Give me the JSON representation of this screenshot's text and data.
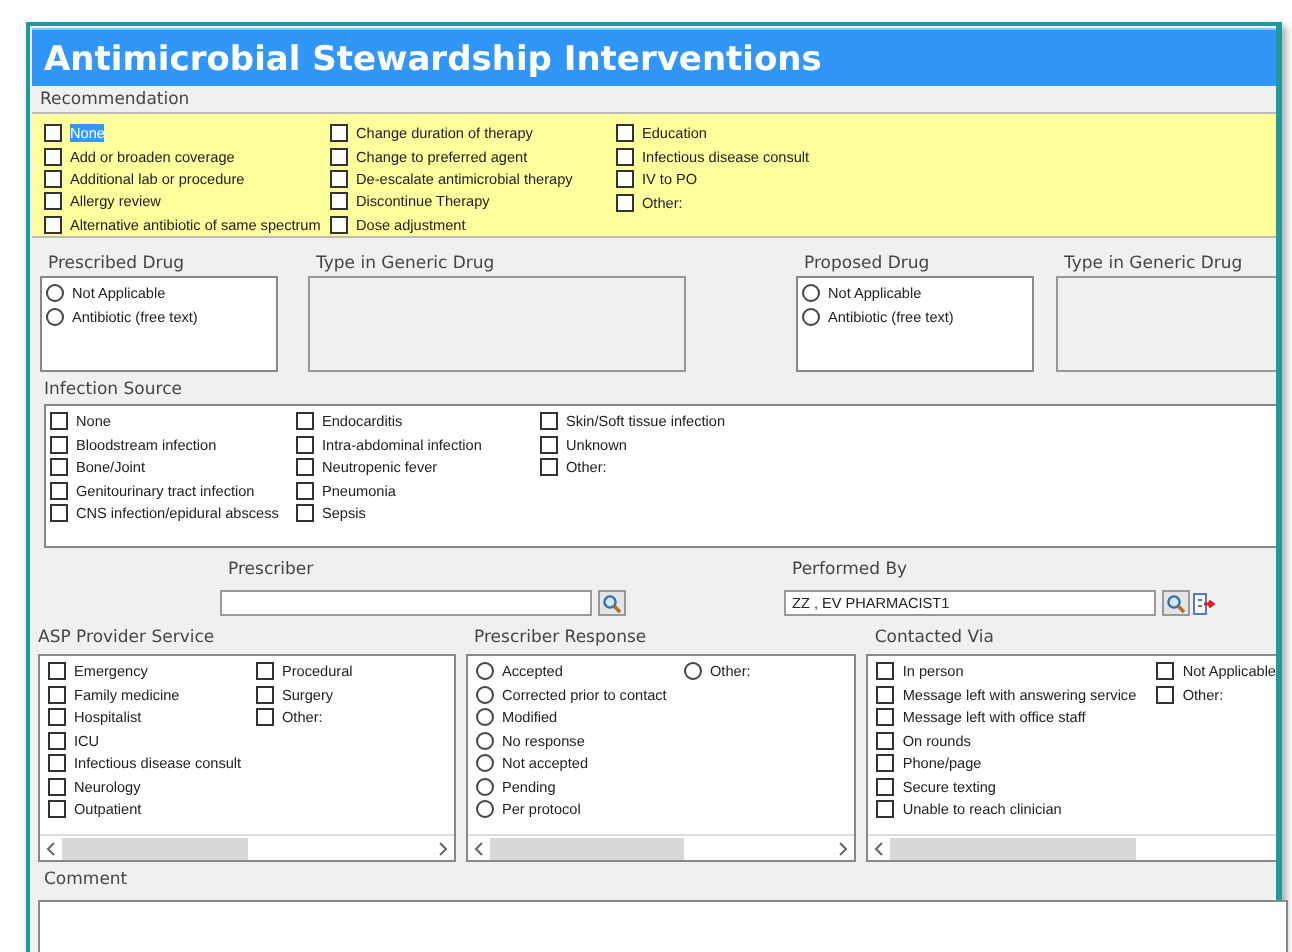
{
  "window": {
    "title": "Antimicrobial Stewardship Interventions"
  },
  "recommendation": {
    "label": "Recommendation",
    "columns": [
      [
        {
          "label": "None",
          "checked": false,
          "focused": true
        },
        {
          "label": "Add or broaden coverage",
          "checked": false,
          "focused": false
        },
        {
          "label": "Additional lab or procedure",
          "checked": false,
          "focused": false
        },
        {
          "label": "Allergy review",
          "checked": false,
          "focused": false
        },
        {
          "label": "Alternative antibiotic of same spectrum",
          "checked": false,
          "focused": false
        }
      ],
      [
        {
          "label": "Change duration of therapy",
          "checked": false,
          "focused": false
        },
        {
          "label": "Change to preferred agent",
          "checked": false,
          "focused": false
        },
        {
          "label": "De-escalate antimicrobial therapy",
          "checked": false,
          "focused": false
        },
        {
          "label": "Discontinue Therapy",
          "checked": false,
          "focused": false
        },
        {
          "label": "Dose adjustment",
          "checked": false,
          "focused": false
        }
      ],
      [
        {
          "label": "Education",
          "checked": false,
          "focused": false
        },
        {
          "label": "Infectious disease consult",
          "checked": false,
          "focused": false
        },
        {
          "label": "IV to PO",
          "checked": false,
          "focused": false
        },
        {
          "label": "Other:",
          "checked": false,
          "focused": false
        }
      ]
    ]
  },
  "prescribed_drug": {
    "label": "Prescribed Drug",
    "options": [
      {
        "label": "Not Applicable",
        "selected": false
      },
      {
        "label": "Antibiotic (free text)",
        "selected": false
      }
    ]
  },
  "prescribed_generic": {
    "label": "Type in Generic Drug"
  },
  "proposed_drug": {
    "label": "Proposed Drug",
    "options": [
      {
        "label": "Not Applicable",
        "selected": false
      },
      {
        "label": "Antibiotic (free text)",
        "selected": false
      }
    ]
  },
  "proposed_generic": {
    "label": "Type in Generic Drug"
  },
  "infection_source": {
    "label": "Infection Source",
    "columns": [
      [
        {
          "label": "None",
          "checked": false
        },
        {
          "label": "Bloodstream infection",
          "checked": false
        },
        {
          "label": "Bone/Joint",
          "checked": false
        },
        {
          "label": "Genitourinary tract infection",
          "checked": false
        },
        {
          "label": "CNS infection/epidural abscess",
          "checked": false
        }
      ],
      [
        {
          "label": "Endocarditis",
          "checked": false
        },
        {
          "label": "Intra-abdominal infection",
          "checked": false
        },
        {
          "label": "Neutropenic fever",
          "checked": false
        },
        {
          "label": "Pneumonia",
          "checked": false
        },
        {
          "label": "Sepsis",
          "checked": false
        }
      ],
      [
        {
          "label": "Skin/Soft tissue infection",
          "checked": false
        },
        {
          "label": "Unknown",
          "checked": false
        },
        {
          "label": "Other:",
          "checked": false
        }
      ]
    ]
  },
  "prescriber": {
    "label": "Prescriber"
  },
  "performed_by": {
    "label": "Performed By",
    "value": "ZZ , EV PHARMACIST1"
  },
  "asp_provider_service": {
    "label": "ASP Provider Service",
    "columns": [
      [
        {
          "label": "Emergency",
          "checked": false
        },
        {
          "label": "Family medicine",
          "checked": false
        },
        {
          "label": "Hospitalist",
          "checked": false
        },
        {
          "label": "ICU",
          "checked": false
        },
        {
          "label": "Infectious disease consult",
          "checked": false
        },
        {
          "label": "Neurology",
          "checked": false
        },
        {
          "label": "Outpatient",
          "checked": false
        }
      ],
      [
        {
          "label": "Procedural",
          "checked": false
        },
        {
          "label": "Surgery",
          "checked": false
        },
        {
          "label": "Other:",
          "checked": false
        }
      ]
    ]
  },
  "prescriber_response": {
    "label": "Prescriber Response",
    "columns": [
      [
        {
          "label": "Accepted",
          "selected": false
        },
        {
          "label": "Corrected prior to contact",
          "selected": false
        },
        {
          "label": "Modified",
          "selected": false
        },
        {
          "label": "No response",
          "selected": false
        },
        {
          "label": "Not accepted",
          "selected": false
        },
        {
          "label": "Pending",
          "selected": false
        },
        {
          "label": "Per protocol",
          "selected": false
        }
      ],
      [
        {
          "label": "Other:",
          "selected": false
        }
      ]
    ]
  },
  "contacted_via": {
    "label": "Contacted Via",
    "columns": [
      [
        {
          "label": "In person",
          "checked": false
        },
        {
          "label": "Message left with answering service",
          "checked": false
        },
        {
          "label": "Message left with office staff",
          "checked": false
        },
        {
          "label": "On rounds",
          "checked": false
        },
        {
          "label": "Phone/page",
          "checked": false
        },
        {
          "label": "Secure texting",
          "checked": false
        },
        {
          "label": "Unable to reach clinician",
          "checked": false
        }
      ],
      [
        {
          "label": "Not Applicable",
          "checked": false
        },
        {
          "label": "Other:",
          "checked": false
        }
      ]
    ]
  },
  "comment": {
    "label": "Comment"
  }
}
